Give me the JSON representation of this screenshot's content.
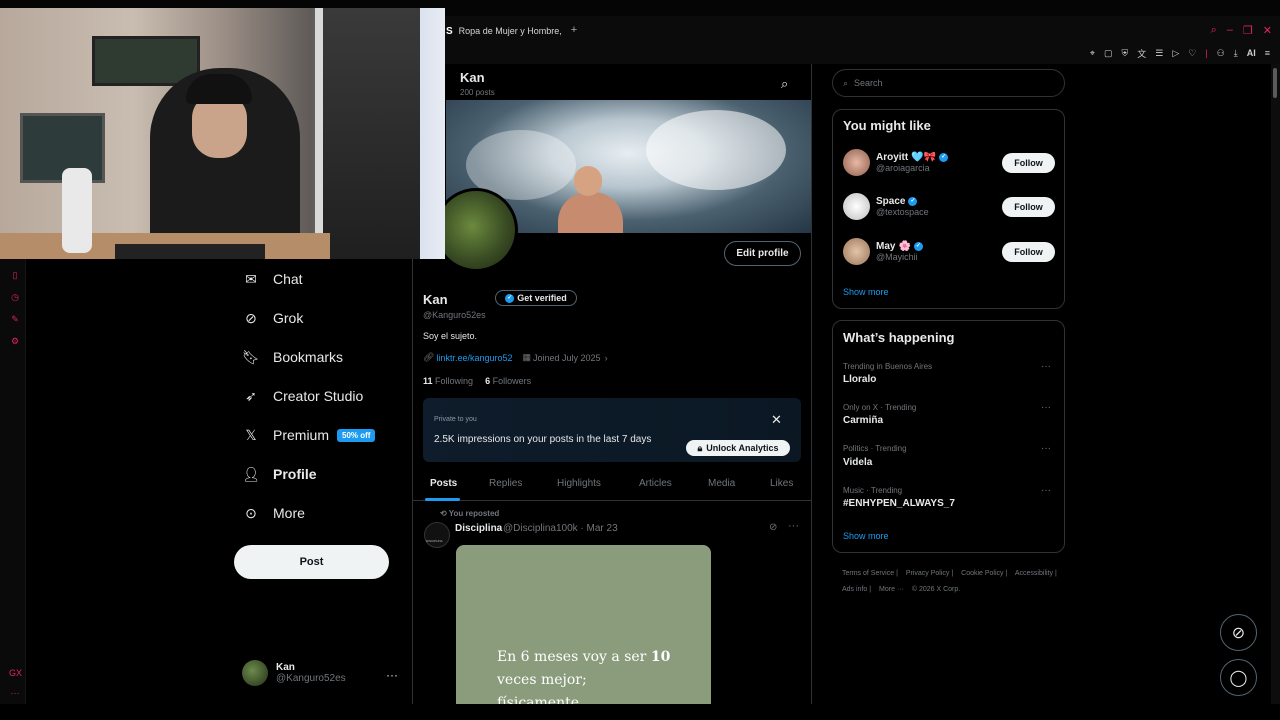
{
  "browser": {
    "tab_title": "Ropa de Mujer y Hombre,",
    "tab_favicon": "S",
    "new_tab_glyph": "+",
    "toolbar_ai_label": "AI",
    "accent": "#e0245e"
  },
  "nav": {
    "items": [
      {
        "label": "Chat",
        "icon": "chat-icon"
      },
      {
        "label": "Grok",
        "icon": "grok-icon"
      },
      {
        "label": "Bookmarks",
        "icon": "bookmark-icon"
      },
      {
        "label": "Creator Studio",
        "icon": "rocket-icon"
      },
      {
        "label": "Premium",
        "icon": "x-logo-icon"
      },
      {
        "label": "Profile",
        "icon": "person-icon"
      },
      {
        "label": "More",
        "icon": "more-circle-icon"
      }
    ],
    "premium_badge": "50% off",
    "post_label": "Post"
  },
  "account": {
    "name": "Kan",
    "handle": "@Kanguro52es",
    "more": "···"
  },
  "profile_header": {
    "name": "Kan",
    "posts": "200 posts"
  },
  "profile": {
    "name": "Kan",
    "verify_label": "Get verified",
    "edit_label": "Edit profile",
    "handle": "@Kanguro52es",
    "bio": "Soy el sujeto.",
    "link": "linktr.ee/kanguro52",
    "joined": "Joined July 2025",
    "following_count": "11",
    "following_label": "Following",
    "followers_count": "6",
    "followers_label": "Followers"
  },
  "analytics": {
    "private": "Private to you",
    "text": "2.5K impressions on your posts in the last 7 days",
    "button": "Unlock Analytics",
    "close": "✕"
  },
  "tabs": [
    "Posts",
    "Replies",
    "Highlights",
    "Articles",
    "Media",
    "Likes"
  ],
  "tweet": {
    "repost_note": "You reposted",
    "name": "Disciplina",
    "handle_date": "@Disciplina100k · Mar 23",
    "avatar_text": "DISCIPLINA",
    "image_text_line1": "En 6 meses voy a ser",
    "image_text_bold": "10",
    "image_text_line2": "veces mejor;",
    "image_text_line3": "físicamente"
  },
  "right": {
    "search_placeholder": "Search",
    "might_like_title": "You might like",
    "suggestions": [
      {
        "name": "Aroyitt",
        "emoji": "🩵🎀",
        "handle": "@aroiagarcia",
        "follow": "Follow"
      },
      {
        "name": "Space",
        "emoji": "",
        "handle": "@textospace",
        "follow": "Follow"
      },
      {
        "name": "May",
        "emoji": "🌸",
        "handle": "@Mayichii",
        "follow": "Follow"
      }
    ],
    "show_more": "Show more",
    "happening_title": "What’s happening",
    "trends": [
      {
        "category": "Trending in Buenos Aires",
        "name": "Lloralo"
      },
      {
        "category": "Only on X · Trending",
        "name": "Carmiña"
      },
      {
        "category": "Politics · Trending",
        "name": "Videla"
      },
      {
        "category": "Music · Trending",
        "name": "#ENHYPEN_ALWAYS_7"
      }
    ],
    "show_more_2": "Show more",
    "footer": [
      "Terms of Service |",
      "Privacy Policy |",
      "Cookie Policy |",
      "Accessibility |",
      "Ads info |",
      "More ··· ",
      "© 2026 X Corp."
    ]
  }
}
